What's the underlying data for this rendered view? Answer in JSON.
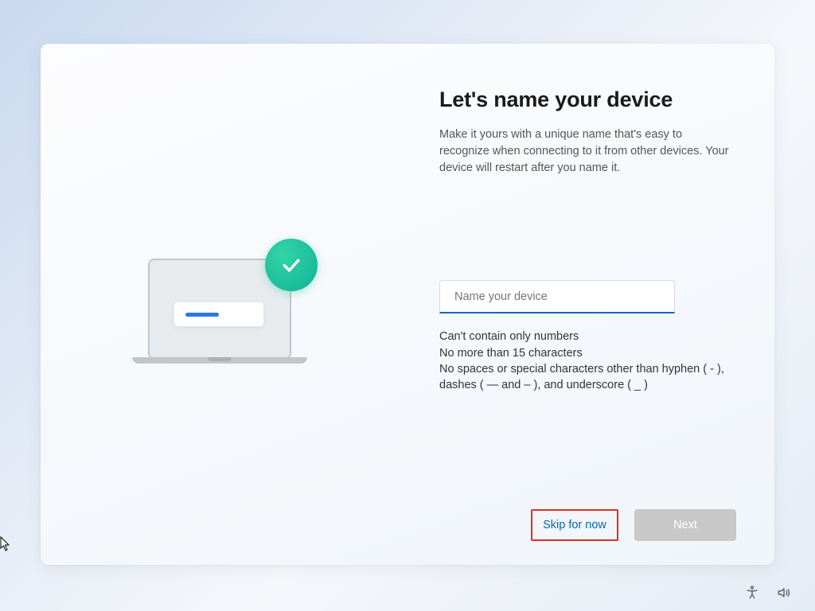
{
  "heading": "Let's name your device",
  "description": "Make it yours with a unique name that's easy to recognize when connecting to it from other devices. Your device will restart after you name it.",
  "input": {
    "placeholder": "Name your device",
    "value": ""
  },
  "rules": {
    "line1": "Can't contain only numbers",
    "line2": "No more than 15 characters",
    "line3": "No spaces or special characters other than hyphen ( - ), dashes ( — and – ), and underscore ( _ )"
  },
  "buttons": {
    "skip": "Skip for now",
    "next": "Next"
  },
  "sys": {
    "accessibility": "accessibility-icon",
    "volume": "volume-icon"
  }
}
